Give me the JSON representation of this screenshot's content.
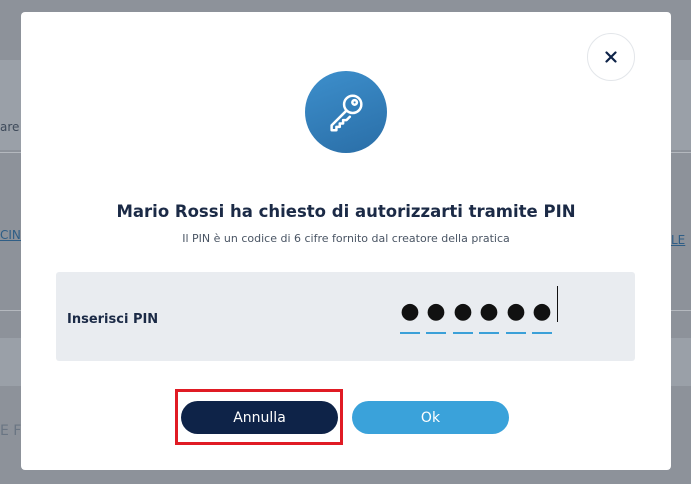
{
  "background": {
    "left_texts": [
      "are",
      "CINA"
    ],
    "right_text": "LE",
    "bottom_left_text": "E F"
  },
  "modal": {
    "title": "Mario Rossi ha chiesto di autorizzarti tramite PIN",
    "subtitle": "Il PIN è un codice di 6 cifre fornito dal creatore della pratica",
    "pin_label": "Inserisci PIN",
    "pin_digits": [
      "●",
      "●",
      "●",
      "●",
      "●",
      "●"
    ],
    "cancel_label": "Annulla",
    "ok_label": "Ok",
    "icons": {
      "close": "close-icon",
      "key": "key-icon"
    }
  },
  "colors": {
    "primary_dark": "#0e2348",
    "accent_blue": "#3aa2da",
    "highlight_red": "#e01b24"
  }
}
